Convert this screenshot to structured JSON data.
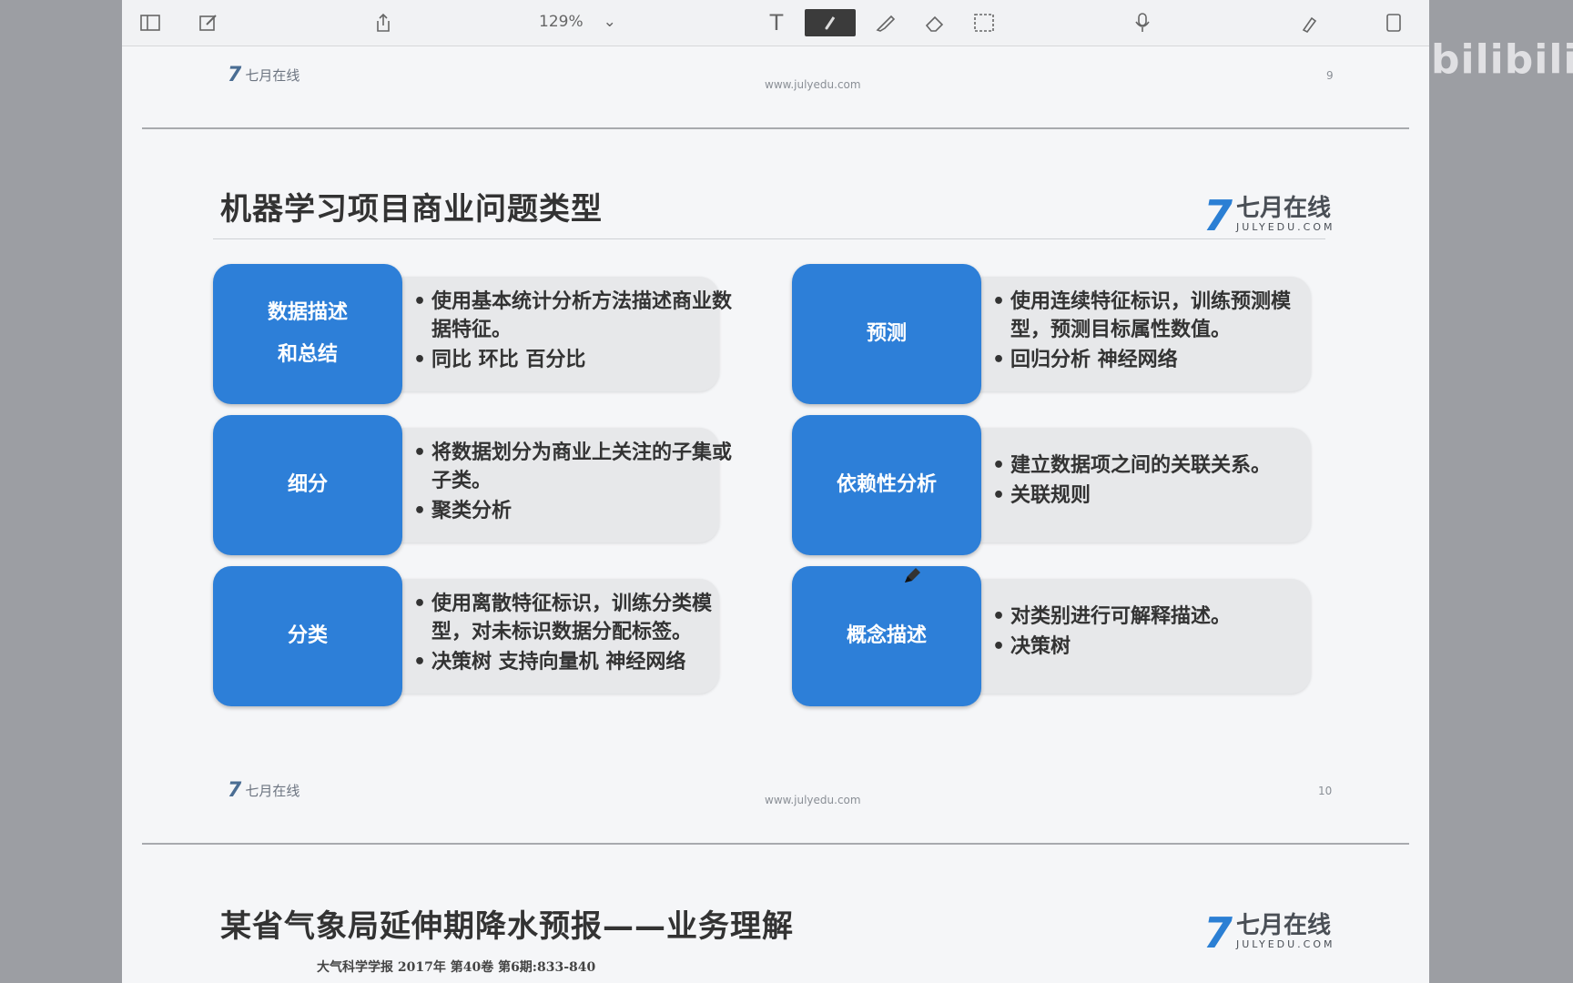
{
  "watermark": "bilibili",
  "toolbar": {
    "zoom": "129%"
  },
  "slide1": {
    "url": "www.julyedu.com",
    "page": "9",
    "logo": "七月在线"
  },
  "slide2": {
    "title": "机器学习项目商业问题类型",
    "brand": {
      "mark": "7",
      "cn": "七月在线",
      "en": "JULYEDU.COM"
    },
    "cards": [
      {
        "label": "数据描述和总结",
        "items": [
          "使用基本统计分析方法描述商业数据特征。",
          "同比  环比  百分比"
        ]
      },
      {
        "label": "预测",
        "items": [
          "使用连续特征标识，训练预测模型，预测目标属性数值。",
          "回归分析  神经网络"
        ]
      },
      {
        "label": "细分",
        "items": [
          "将数据划分为商业上关注的子集或子类。",
          "聚类分析"
        ]
      },
      {
        "label": "依赖性分析",
        "items": [
          "建立数据项之间的关联关系。",
          "关联规则"
        ]
      },
      {
        "label": "分类",
        "items": [
          "使用离散特征标识，训练分类模型，对未标识数据分配标签。",
          "决策树  支持向量机  神经网络"
        ]
      },
      {
        "label": "概念描述",
        "items": [
          "对类别进行可解释描述。",
          "决策树"
        ]
      }
    ],
    "footer_logo": "七月在线",
    "url": "www.julyedu.com",
    "page": "10"
  },
  "slide3": {
    "title": "某省气象局延伸期降水预报——业务理解",
    "brand": {
      "mark": "7",
      "cn": "七月在线",
      "en": "JULYEDU.COM"
    },
    "citation": "大气科学学报   2017年   第40卷   第6期:833-840"
  }
}
